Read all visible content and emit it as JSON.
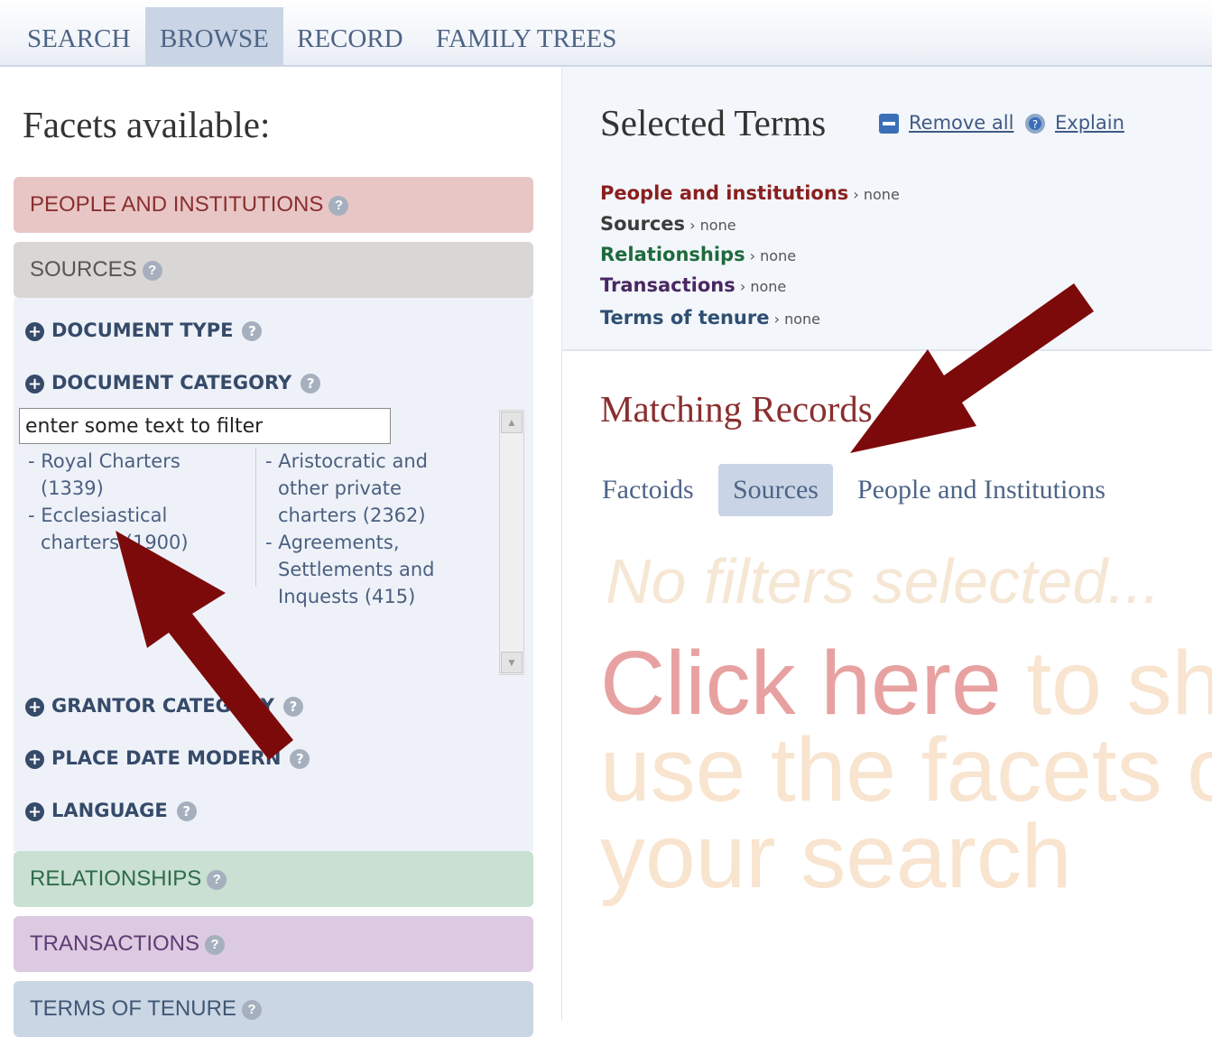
{
  "nav": {
    "tabs": [
      {
        "label": "SEARCH"
      },
      {
        "label": "BROWSE"
      },
      {
        "label": "RECORD"
      },
      {
        "label": "FAMILY TREES"
      }
    ],
    "active": "BROWSE"
  },
  "facets": {
    "title": "Facets available:",
    "people": "PEOPLE AND INSTITUTIONS",
    "sources": "SOURCES",
    "relationships": "RELATIONSHIPS",
    "transactions": "TRANSACTIONS",
    "tenure": "TERMS OF TENURE",
    "sub": {
      "doctype": "DOCUMENT TYPE",
      "doccat": "DOCUMENT CATEGORY",
      "grantor": "GRANTOR CATEGORY",
      "place": "PLACE DATE MODERN",
      "language": "LANGUAGE"
    },
    "filter": {
      "value": "enter some text to filter"
    },
    "categories": [
      "Royal Charters (1339)",
      "Ecclesiastical charters (1900)",
      "Aristocratic and other private charters (2362)",
      "Agreements, Settlements and Inquests (415)"
    ]
  },
  "selected": {
    "title": "Selected Terms",
    "remove_all": "Remove all",
    "explain": "Explain",
    "none": "none",
    "terms": [
      {
        "label": "People and institutions",
        "color": "#8a1f1f"
      },
      {
        "label": "Sources",
        "color": "#3c3c3c"
      },
      {
        "label": "Relationships",
        "color": "#1e6a3e"
      },
      {
        "label": "Transactions",
        "color": "#4a2762"
      },
      {
        "label": "Terms of tenure",
        "color": "#2f4f73"
      }
    ]
  },
  "matching": {
    "title": "Matching Records",
    "tabs": [
      "Factoids",
      "Sources",
      "People and Institutions"
    ],
    "active_tab": "Sources",
    "no_filters": "No filters selected...",
    "click_here": "Click here",
    "click_rest1": " to sh",
    "line2": "use the facets o",
    "line3": "your search"
  },
  "colors": {
    "arrow": "#7d0a0a",
    "accent": "#4e6486"
  }
}
